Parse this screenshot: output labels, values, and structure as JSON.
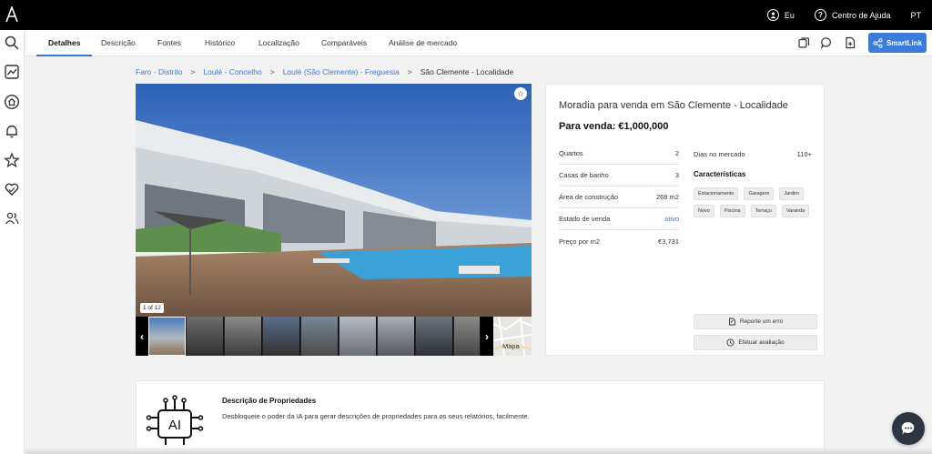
{
  "topbar": {
    "user_label": "Eu",
    "help_label": "Centro de Ajuda",
    "lang": "PT",
    "help_glyph": "?"
  },
  "tabs": [
    {
      "label": "Detalhes",
      "active": true
    },
    {
      "label": "Descrição"
    },
    {
      "label": "Fontes"
    },
    {
      "label": "Histórico"
    },
    {
      "label": "Localização"
    },
    {
      "label": "Comparáveis"
    },
    {
      "label": "Análise de mercado"
    }
  ],
  "smartlink_label": "SmartLink",
  "breadcrumb": {
    "items": [
      "Faro - Distrito",
      "Loulé - Concelho",
      "Loulé (São Clemente) - Freguesia",
      "São Clemente - Localidade"
    ],
    "sep": ">"
  },
  "gallery": {
    "counter": "1 of 12",
    "map_label": "Mapa",
    "prev": "‹",
    "next": "›",
    "fav_glyph": "☆"
  },
  "property": {
    "title": "Moradia para venda em São Clemente - Localidade",
    "price": "Para venda: €1,000,000",
    "details": [
      {
        "label": "Quartos",
        "value": "2"
      },
      {
        "label": "Casas de banho",
        "value": "3"
      },
      {
        "label": "Área de construção",
        "value": "268 m2"
      },
      {
        "label": "Estado de venda",
        "value": "ativo",
        "link": true
      },
      {
        "label": "Preço por m2",
        "value": "€3,731"
      }
    ],
    "days_label": "Dias no mercado",
    "days_value": "110+",
    "features_title": "Características",
    "features": [
      "Estacionamento",
      "Garagem",
      "Jardim",
      "Novo",
      "Piscina",
      "Terraço",
      "Varanda"
    ],
    "report_label": "Reporte um erro",
    "evaluate_label": "Efetuar avaliação"
  },
  "description": {
    "title": "Descrição de Propriedades",
    "text": "Desbloqueie o poder da IA para gerar descrições de propriedades para os seus relatórios, facilmente.",
    "ai_label": "AI"
  },
  "colors": {
    "accent": "#3b7bd9",
    "topbar": "#000000"
  }
}
